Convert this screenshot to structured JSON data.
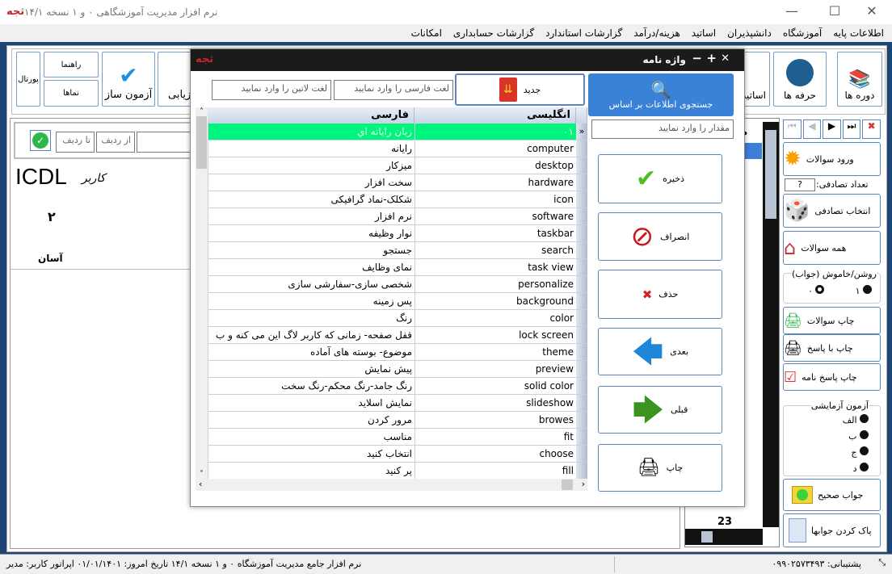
{
  "window": {
    "title": "نرم افزار مدیریت آموزشگاهی ۰ و ۱ نسخه ۱۴/۱",
    "logo": "ثجه"
  },
  "menu": [
    "اطلاعات پایه",
    "آموزشگاه",
    "دانشپذیران",
    "اساتید",
    "هزینه/درآمد",
    "گزارشات استاندارد",
    "گزارشات حسابداری",
    "امکانات"
  ],
  "toolbar": {
    "courses": "دوره ها",
    "professions": "حرفه ها",
    "teachers": "اساتید",
    "portal": "پورتال",
    "guide": "راهنما",
    "views": "نماها",
    "exam_builder": "آزمون ساز",
    "evaluation": "ارزیابی"
  },
  "left_panel": {
    "question_placeholder": "؟",
    "from_row": "از ردیف",
    "to_row": "تا ردیف",
    "title": "ICDL",
    "user_label": "کاربر",
    "number": "۲",
    "level": "آسان"
  },
  "dialog": {
    "title": "واژه نامه",
    "search_label": "جستجوی اطلاعات بر اساس",
    "search_placeholder": "مقدار را وارد نمایید",
    "new_label": "جدید",
    "persian_placeholder": "لغت فارسی را وارد نمایید",
    "latin_placeholder": "لغت لاتین را وارد نمایید",
    "columns": {
      "english": "انگلیسی",
      "persian": "فارسی"
    },
    "rows": [
      {
        "en": "۰۱",
        "fa": "زبان رایانه اي"
      },
      {
        "en": "computer",
        "fa": "رایانه"
      },
      {
        "en": "desktop",
        "fa": "میزکار"
      },
      {
        "en": "hardware",
        "fa": "سخت افزار"
      },
      {
        "en": "icon",
        "fa": "شکلک-نماد گرافیکی"
      },
      {
        "en": "software",
        "fa": "نرم افزار"
      },
      {
        "en": "taskbar",
        "fa": "نوار وظیفه"
      },
      {
        "en": "search",
        "fa": "جستجو"
      },
      {
        "en": "task view",
        "fa": "نمای وظایف"
      },
      {
        "en": "personalize",
        "fa": "شخصی سازی-سفارشی سازی"
      },
      {
        "en": "background",
        "fa": "پس زمینه"
      },
      {
        "en": "color",
        "fa": "رنگ"
      },
      {
        "en": "lock screen",
        "fa": "قفل صفحه- زمانی که کاربر لاگ این می کنه و ب"
      },
      {
        "en": "theme",
        "fa": "موضوع- بوسته های آماده"
      },
      {
        "en": "preview",
        "fa": "پیش نمایش"
      },
      {
        "en": "solid color",
        "fa": "رنگ جامد-رنگ محکم-رنگ سخت"
      },
      {
        "en": "slideshow",
        "fa": "نمایش اسلاید"
      },
      {
        "en": "browes",
        "fa": "مرور کردن"
      },
      {
        "en": "fit",
        "fa": "مناسب"
      },
      {
        "en": "choose",
        "fa": "انتخاب کنید"
      },
      {
        "en": "fill",
        "fa": "پر کنید"
      }
    ],
    "selected_row_color": "#00f57f",
    "buttons": {
      "save": "ذخیره",
      "cancel": "انصراف",
      "delete": "حذف",
      "next": "بعدی",
      "prev": "قبلی",
      "print": "چاپ"
    }
  },
  "middle_grid": {
    "header": "مر",
    "footer_value": "23"
  },
  "right_panel": {
    "enter_questions": "ورود سوالات",
    "random_count_label": "تعداد تصادفی:",
    "random_count_value": "?",
    "random_select": "انتخاب تصادفی",
    "all_questions": "همه سوالات",
    "toggle_group": "روشن/خاموش (جواب)",
    "toggle_on": "۱",
    "toggle_off": "۰",
    "print_questions": "چاپ سوالات",
    "print_with_answer": "چاپ با پاسخ",
    "print_answer_sheet": "چاپ پاسخ نامه",
    "trial_group": "آزمون آزمایشی",
    "options": [
      "الف",
      "ب",
      "ج",
      "د"
    ],
    "correct_answer": "جواب صحیح",
    "clear_answers": "پاک کردن جوابها"
  },
  "status": {
    "support": "پشتیبانی: ۰۹۹۰۲۵۷۳۴۹۳",
    "info": "نرم افزار جامع مدیریت آموزشگاه ۰ و ۱ نسخه ۱۴/۱   تاریخ امروز: ۰۱/۰۱/۱۴۰۱   اپراتور کاربر: مدیر"
  }
}
